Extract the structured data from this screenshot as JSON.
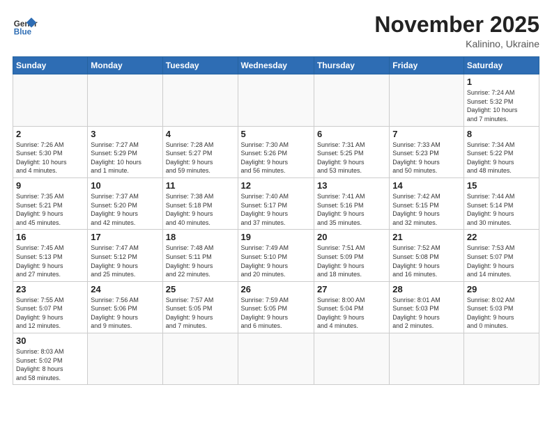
{
  "header": {
    "logo_general": "General",
    "logo_blue": "Blue",
    "month_title": "November 2025",
    "location": "Kalinino, Ukraine"
  },
  "weekdays": [
    "Sunday",
    "Monday",
    "Tuesday",
    "Wednesday",
    "Thursday",
    "Friday",
    "Saturday"
  ],
  "weeks": [
    [
      {
        "day": "",
        "info": ""
      },
      {
        "day": "",
        "info": ""
      },
      {
        "day": "",
        "info": ""
      },
      {
        "day": "",
        "info": ""
      },
      {
        "day": "",
        "info": ""
      },
      {
        "day": "",
        "info": ""
      },
      {
        "day": "1",
        "info": "Sunrise: 7:24 AM\nSunset: 5:32 PM\nDaylight: 10 hours\nand 7 minutes."
      }
    ],
    [
      {
        "day": "2",
        "info": "Sunrise: 7:26 AM\nSunset: 5:30 PM\nDaylight: 10 hours\nand 4 minutes."
      },
      {
        "day": "3",
        "info": "Sunrise: 7:27 AM\nSunset: 5:29 PM\nDaylight: 10 hours\nand 1 minute."
      },
      {
        "day": "4",
        "info": "Sunrise: 7:28 AM\nSunset: 5:27 PM\nDaylight: 9 hours\nand 59 minutes."
      },
      {
        "day": "5",
        "info": "Sunrise: 7:30 AM\nSunset: 5:26 PM\nDaylight: 9 hours\nand 56 minutes."
      },
      {
        "day": "6",
        "info": "Sunrise: 7:31 AM\nSunset: 5:25 PM\nDaylight: 9 hours\nand 53 minutes."
      },
      {
        "day": "7",
        "info": "Sunrise: 7:33 AM\nSunset: 5:23 PM\nDaylight: 9 hours\nand 50 minutes."
      },
      {
        "day": "8",
        "info": "Sunrise: 7:34 AM\nSunset: 5:22 PM\nDaylight: 9 hours\nand 48 minutes."
      }
    ],
    [
      {
        "day": "9",
        "info": "Sunrise: 7:35 AM\nSunset: 5:21 PM\nDaylight: 9 hours\nand 45 minutes."
      },
      {
        "day": "10",
        "info": "Sunrise: 7:37 AM\nSunset: 5:20 PM\nDaylight: 9 hours\nand 42 minutes."
      },
      {
        "day": "11",
        "info": "Sunrise: 7:38 AM\nSunset: 5:18 PM\nDaylight: 9 hours\nand 40 minutes."
      },
      {
        "day": "12",
        "info": "Sunrise: 7:40 AM\nSunset: 5:17 PM\nDaylight: 9 hours\nand 37 minutes."
      },
      {
        "day": "13",
        "info": "Sunrise: 7:41 AM\nSunset: 5:16 PM\nDaylight: 9 hours\nand 35 minutes."
      },
      {
        "day": "14",
        "info": "Sunrise: 7:42 AM\nSunset: 5:15 PM\nDaylight: 9 hours\nand 32 minutes."
      },
      {
        "day": "15",
        "info": "Sunrise: 7:44 AM\nSunset: 5:14 PM\nDaylight: 9 hours\nand 30 minutes."
      }
    ],
    [
      {
        "day": "16",
        "info": "Sunrise: 7:45 AM\nSunset: 5:13 PM\nDaylight: 9 hours\nand 27 minutes."
      },
      {
        "day": "17",
        "info": "Sunrise: 7:47 AM\nSunset: 5:12 PM\nDaylight: 9 hours\nand 25 minutes."
      },
      {
        "day": "18",
        "info": "Sunrise: 7:48 AM\nSunset: 5:11 PM\nDaylight: 9 hours\nand 22 minutes."
      },
      {
        "day": "19",
        "info": "Sunrise: 7:49 AM\nSunset: 5:10 PM\nDaylight: 9 hours\nand 20 minutes."
      },
      {
        "day": "20",
        "info": "Sunrise: 7:51 AM\nSunset: 5:09 PM\nDaylight: 9 hours\nand 18 minutes."
      },
      {
        "day": "21",
        "info": "Sunrise: 7:52 AM\nSunset: 5:08 PM\nDaylight: 9 hours\nand 16 minutes."
      },
      {
        "day": "22",
        "info": "Sunrise: 7:53 AM\nSunset: 5:07 PM\nDaylight: 9 hours\nand 14 minutes."
      }
    ],
    [
      {
        "day": "23",
        "info": "Sunrise: 7:55 AM\nSunset: 5:07 PM\nDaylight: 9 hours\nand 12 minutes."
      },
      {
        "day": "24",
        "info": "Sunrise: 7:56 AM\nSunset: 5:06 PM\nDaylight: 9 hours\nand 9 minutes."
      },
      {
        "day": "25",
        "info": "Sunrise: 7:57 AM\nSunset: 5:05 PM\nDaylight: 9 hours\nand 7 minutes."
      },
      {
        "day": "26",
        "info": "Sunrise: 7:59 AM\nSunset: 5:05 PM\nDaylight: 9 hours\nand 6 minutes."
      },
      {
        "day": "27",
        "info": "Sunrise: 8:00 AM\nSunset: 5:04 PM\nDaylight: 9 hours\nand 4 minutes."
      },
      {
        "day": "28",
        "info": "Sunrise: 8:01 AM\nSunset: 5:03 PM\nDaylight: 9 hours\nand 2 minutes."
      },
      {
        "day": "29",
        "info": "Sunrise: 8:02 AM\nSunset: 5:03 PM\nDaylight: 9 hours\nand 0 minutes."
      }
    ],
    [
      {
        "day": "30",
        "info": "Sunrise: 8:03 AM\nSunset: 5:02 PM\nDaylight: 8 hours\nand 58 minutes."
      },
      {
        "day": "",
        "info": ""
      },
      {
        "day": "",
        "info": ""
      },
      {
        "day": "",
        "info": ""
      },
      {
        "day": "",
        "info": ""
      },
      {
        "day": "",
        "info": ""
      },
      {
        "day": "",
        "info": ""
      }
    ]
  ]
}
